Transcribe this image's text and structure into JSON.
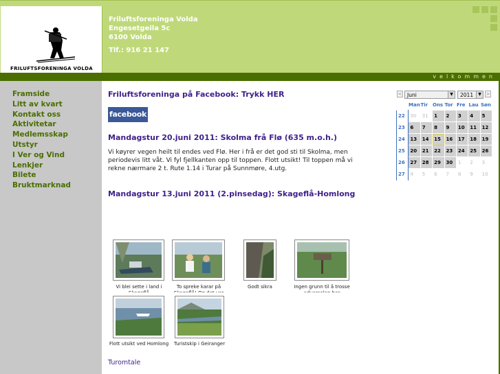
{
  "header": {
    "logo_text": "FRILUFTSFORENINGA VOLDA",
    "address_lines": [
      "Friluftsforeninga Volda",
      "Engesetgeila 5c",
      "6100 Volda"
    ],
    "phone": "Tlf.: 916 21 147",
    "welcome": "velkommen"
  },
  "sidebar": {
    "items": [
      {
        "label": "Framside"
      },
      {
        "label": "Litt av kvart"
      },
      {
        "label": "Kontakt oss"
      },
      {
        "label": "Aktivitetar"
      },
      {
        "label": "Medlemsskap"
      },
      {
        "label": "Utstyr"
      },
      {
        "label": "I Ver og Vind"
      },
      {
        "label": "Lenkjer"
      },
      {
        "label": "Bilete"
      },
      {
        "label": "Bruktmarknad"
      }
    ]
  },
  "main": {
    "facebook_link": "Friluftsforeninga på Facebook: Trykk HER",
    "facebook_badge": "facebook",
    "posts": [
      {
        "title": "Mandagstur 20.juni 2011: Skolma frå Flø (635 m.o.h.)",
        "body": "Vi køyrer vegen heilt til endes ved Flø. Her i frå er det god sti til Skolma, men periodevis litt våt. Vi fyl fjellkanten opp til toppen. Flott utsikt! Til toppen må vi rekne nærmare 2 t. Rute 1.14 i Turar på Sunnmøre, 4.utg."
      },
      {
        "title": "Mandagstur 13.juni 2011 (2.pinsedag): Skageflå-Homlong"
      }
    ],
    "gallery": [
      {
        "caption": "Vi blei sette i land i Skageflå"
      },
      {
        "caption": "To spreke karar på Skageflå! Og det var"
      },
      {
        "caption": "Godt sikra"
      },
      {
        "caption": "Ingen grunn til å trosse advarselen her"
      },
      {
        "caption": "Flott utsikt ved Homlong"
      },
      {
        "caption": "Turistskip i Geiranger"
      }
    ],
    "turomtale": "Turomtale"
  },
  "calendar": {
    "month": "Juni",
    "year": "2011",
    "prev": "<",
    "next": ">",
    "weekdays": [
      "Man",
      "Tir",
      "Ons",
      "Tor",
      "Fre",
      "Lau",
      "Søn"
    ],
    "weeks": [
      {
        "week": "22",
        "days": [
          "30",
          "31",
          "1",
          "2",
          "3",
          "4",
          "5"
        ]
      },
      {
        "week": "23",
        "days": [
          "6",
          "7",
          "8",
          "9",
          "10",
          "11",
          "12"
        ]
      },
      {
        "week": "24",
        "days": [
          "13",
          "14",
          "15",
          "16",
          "17",
          "18",
          "19"
        ]
      },
      {
        "week": "25",
        "days": [
          "20",
          "21",
          "22",
          "23",
          "24",
          "25",
          "26"
        ]
      },
      {
        "week": "26",
        "days": [
          "27",
          "28",
          "29",
          "30",
          "1",
          "2",
          "3"
        ]
      },
      {
        "week": "27",
        "days": [
          "4",
          "5",
          "6",
          "7",
          "8",
          "9",
          "10"
        ]
      }
    ],
    "today": "15"
  }
}
